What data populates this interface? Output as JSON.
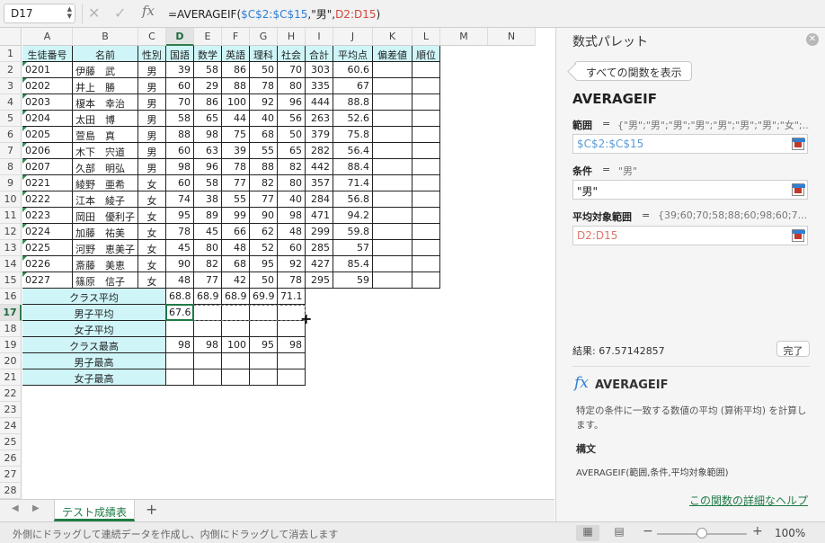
{
  "formula_bar": {
    "name_box": "D17",
    "cancel_icon": "close-icon",
    "accept_icon": "check-icon",
    "fx_label": "fx",
    "formula_prefix": "=AVERAGEIF(",
    "formula_arg1": "$C$2:$C$15",
    "formula_comma1": ",\"男\",",
    "formula_arg3": "D2:D15",
    "formula_suffix": ")"
  },
  "columns": [
    {
      "letter": "A",
      "header": "生徒番号"
    },
    {
      "letter": "B",
      "header": "名前"
    },
    {
      "letter": "C",
      "header": "性別"
    },
    {
      "letter": "D",
      "header": "国語"
    },
    {
      "letter": "E",
      "header": "数学"
    },
    {
      "letter": "F",
      "header": "英語"
    },
    {
      "letter": "G",
      "header": "理科"
    },
    {
      "letter": "H",
      "header": "社会"
    },
    {
      "letter": "I",
      "header": "合計"
    },
    {
      "letter": "J",
      "header": "平均点"
    },
    {
      "letter": "K",
      "header": "偏差値"
    },
    {
      "letter": "L",
      "header": "順位"
    },
    {
      "letter": "M",
      "header": ""
    },
    {
      "letter": "N",
      "header": ""
    }
  ],
  "row_numbers": [
    "1",
    "2",
    "3",
    "4",
    "5",
    "6",
    "7",
    "8",
    "9",
    "10",
    "11",
    "12",
    "13",
    "14",
    "15",
    "16",
    "17",
    "18",
    "19",
    "20",
    "21",
    "22",
    "23",
    "24",
    "25",
    "26",
    "27",
    "28"
  ],
  "students": [
    {
      "id": "0201",
      "name": "伊藤　武",
      "gender": "男",
      "jp": "39",
      "math": "58",
      "en": "86",
      "sci": "50",
      "soc": "70",
      "total": "303",
      "avg": "60.6"
    },
    {
      "id": "0202",
      "name": "井上　勝",
      "gender": "男",
      "jp": "60",
      "math": "29",
      "en": "88",
      "sci": "78",
      "soc": "80",
      "total": "335",
      "avg": "67"
    },
    {
      "id": "0203",
      "name": "榎本　幸治",
      "gender": "男",
      "jp": "70",
      "math": "86",
      "en": "100",
      "sci": "92",
      "soc": "96",
      "total": "444",
      "avg": "88.8"
    },
    {
      "id": "0204",
      "name": "太田　博",
      "gender": "男",
      "jp": "58",
      "math": "65",
      "en": "44",
      "sci": "40",
      "soc": "56",
      "total": "263",
      "avg": "52.6"
    },
    {
      "id": "0205",
      "name": "萱島　真",
      "gender": "男",
      "jp": "88",
      "math": "98",
      "en": "75",
      "sci": "68",
      "soc": "50",
      "total": "379",
      "avg": "75.8"
    },
    {
      "id": "0206",
      "name": "木下　宍道",
      "gender": "男",
      "jp": "60",
      "math": "63",
      "en": "39",
      "sci": "55",
      "soc": "65",
      "total": "282",
      "avg": "56.4"
    },
    {
      "id": "0207",
      "name": "久部　明弘",
      "gender": "男",
      "jp": "98",
      "math": "96",
      "en": "78",
      "sci": "88",
      "soc": "82",
      "total": "442",
      "avg": "88.4"
    },
    {
      "id": "0221",
      "name": "綾野　亜希",
      "gender": "女",
      "jp": "60",
      "math": "58",
      "en": "77",
      "sci": "82",
      "soc": "80",
      "total": "357",
      "avg": "71.4"
    },
    {
      "id": "0222",
      "name": "江本　綾子",
      "gender": "女",
      "jp": "74",
      "math": "38",
      "en": "55",
      "sci": "77",
      "soc": "40",
      "total": "284",
      "avg": "56.8"
    },
    {
      "id": "0223",
      "name": "岡田　優利子",
      "gender": "女",
      "jp": "95",
      "math": "89",
      "en": "99",
      "sci": "90",
      "soc": "98",
      "total": "471",
      "avg": "94.2"
    },
    {
      "id": "0224",
      "name": "加藤　祐美",
      "gender": "女",
      "jp": "78",
      "math": "45",
      "en": "66",
      "sci": "62",
      "soc": "48",
      "total": "299",
      "avg": "59.8"
    },
    {
      "id": "0225",
      "name": "河野　恵美子",
      "gender": "女",
      "jp": "45",
      "math": "80",
      "en": "48",
      "sci": "52",
      "soc": "60",
      "total": "285",
      "avg": "57"
    },
    {
      "id": "0226",
      "name": "斎藤　美恵",
      "gender": "女",
      "jp": "90",
      "math": "82",
      "en": "68",
      "sci": "95",
      "soc": "92",
      "total": "427",
      "avg": "85.4"
    },
    {
      "id": "0227",
      "name": "篠原　信子",
      "gender": "女",
      "jp": "48",
      "math": "77",
      "en": "42",
      "sci": "50",
      "soc": "78",
      "total": "295",
      "avg": "59"
    }
  ],
  "summary_rows": [
    {
      "label": "クラス平均",
      "values": [
        "68.8",
        "68.9",
        "68.9",
        "69.9",
        "71.1"
      ]
    },
    {
      "label": "男子平均",
      "values": [
        "67.6",
        "",
        "",
        "",
        ""
      ]
    },
    {
      "label": "女子平均",
      "values": [
        "",
        "",
        "",
        "",
        ""
      ]
    },
    {
      "label": "クラス最高",
      "values": [
        "98",
        "98",
        "100",
        "95",
        "98"
      ]
    },
    {
      "label": "男子最高",
      "values": [
        "",
        "",
        "",
        "",
        ""
      ]
    },
    {
      "label": "女子最高",
      "values": [
        "",
        "",
        "",
        "",
        ""
      ]
    }
  ],
  "sheet_tabs": {
    "active": "テスト成績表",
    "add_icon": "plus-icon"
  },
  "status_bar": {
    "message": "外側にドラッグして連続データを作成し、内側にドラッグして消去します",
    "zoom": "100%",
    "zoom_level": 0.5
  },
  "builder": {
    "title": "数式パレット",
    "show_all": "すべての関数を表示",
    "function": "AVERAGEIF",
    "args": [
      {
        "label": "範囲",
        "eq": "=",
        "preview": "{\"男\";\"男\";\"男\";\"男\";\"男\";\"男\";\"男\";\"女\";...",
        "input": "$C$2:$C$15"
      },
      {
        "label": "条件",
        "eq": "=",
        "preview": "\"男\"",
        "input": "\"男\""
      },
      {
        "label": "平均対象範囲",
        "eq": "=",
        "preview": "{39;60;70;58;88;60;98;60;7...",
        "input": "D2:D15"
      }
    ],
    "result": "結果: 67.57142857",
    "done": "完了",
    "help_fx": "fx",
    "help_name": "AVERAGEIF",
    "help_desc": "特定の条件に一致する数値の平均 (算術平均) を計算します。",
    "syntax_heading": "構文",
    "syntax": "AVERAGEIF(範囲,条件,平均対象範囲)",
    "help_link": "この関数の詳細なヘルプ"
  }
}
